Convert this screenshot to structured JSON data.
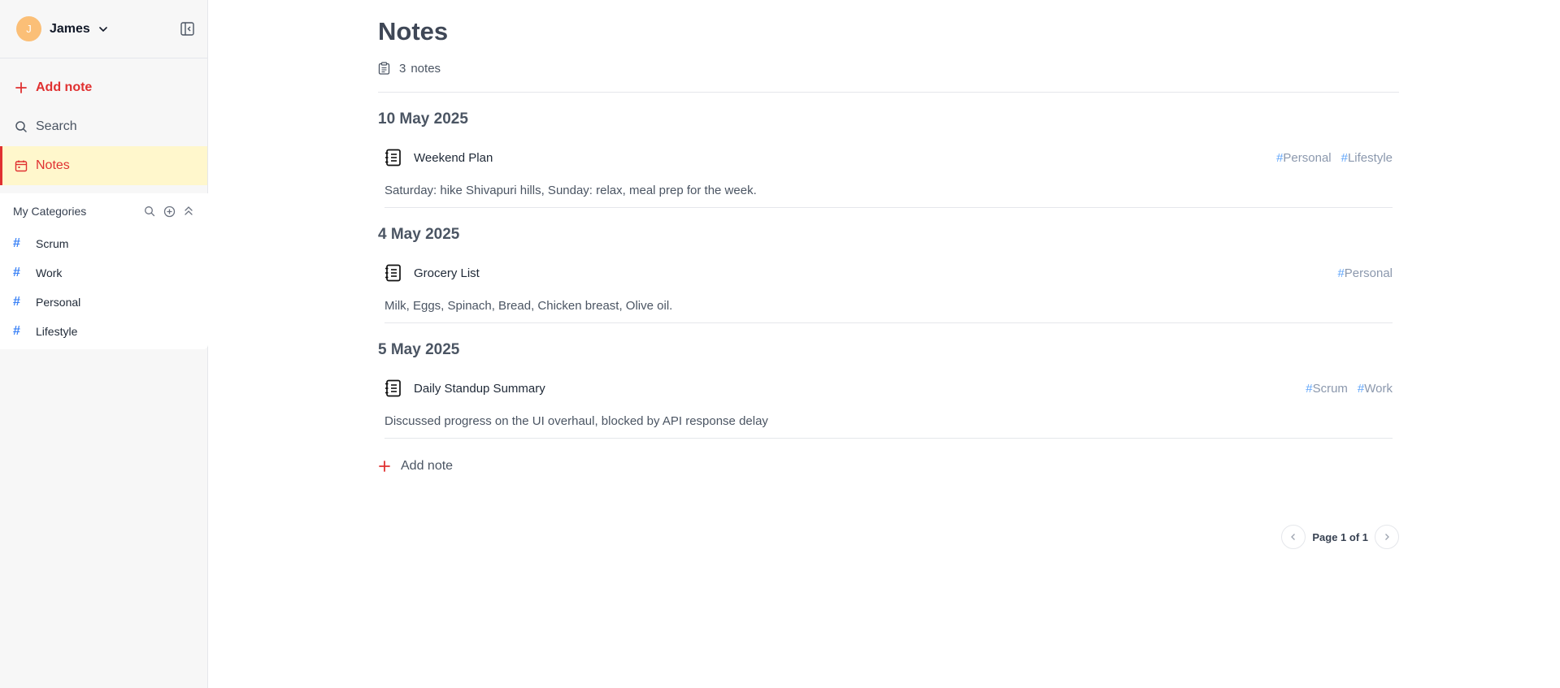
{
  "user": {
    "initial": "J",
    "name": "James"
  },
  "nav": {
    "add_note": "Add note",
    "search": "Search",
    "notes": "Notes"
  },
  "categories": {
    "title": "My Categories",
    "items": [
      {
        "label": "Scrum"
      },
      {
        "label": "Work"
      },
      {
        "label": "Personal"
      },
      {
        "label": "Lifestyle"
      }
    ]
  },
  "main": {
    "title": "Notes",
    "count": "3",
    "count_label": "notes",
    "groups": [
      {
        "date": "10 May 2025",
        "note": {
          "title": "Weekend Plan",
          "tags": [
            "Personal",
            "Lifestyle"
          ],
          "body": "Saturday: hike Shivapuri hills, Sunday: relax, meal prep for the week."
        }
      },
      {
        "date": "4 May 2025",
        "note": {
          "title": "Grocery List",
          "tags": [
            "Personal"
          ],
          "body": "Milk, Eggs, Spinach, Bread, Chicken breast, Olive oil."
        }
      },
      {
        "date": "5 May 2025",
        "note": {
          "title": "Daily Standup Summary",
          "tags": [
            "Scrum",
            "Work"
          ],
          "body": "Discussed progress on the UI overhaul, blocked by API response delay"
        }
      }
    ],
    "add_note": "Add note",
    "pagination": "Page 1 of 1"
  },
  "colors": {
    "accent_red": "#e03131",
    "active_bg": "#fff7cc",
    "tag_hash": "#60a5fa",
    "avatar": "#fbbf77"
  }
}
